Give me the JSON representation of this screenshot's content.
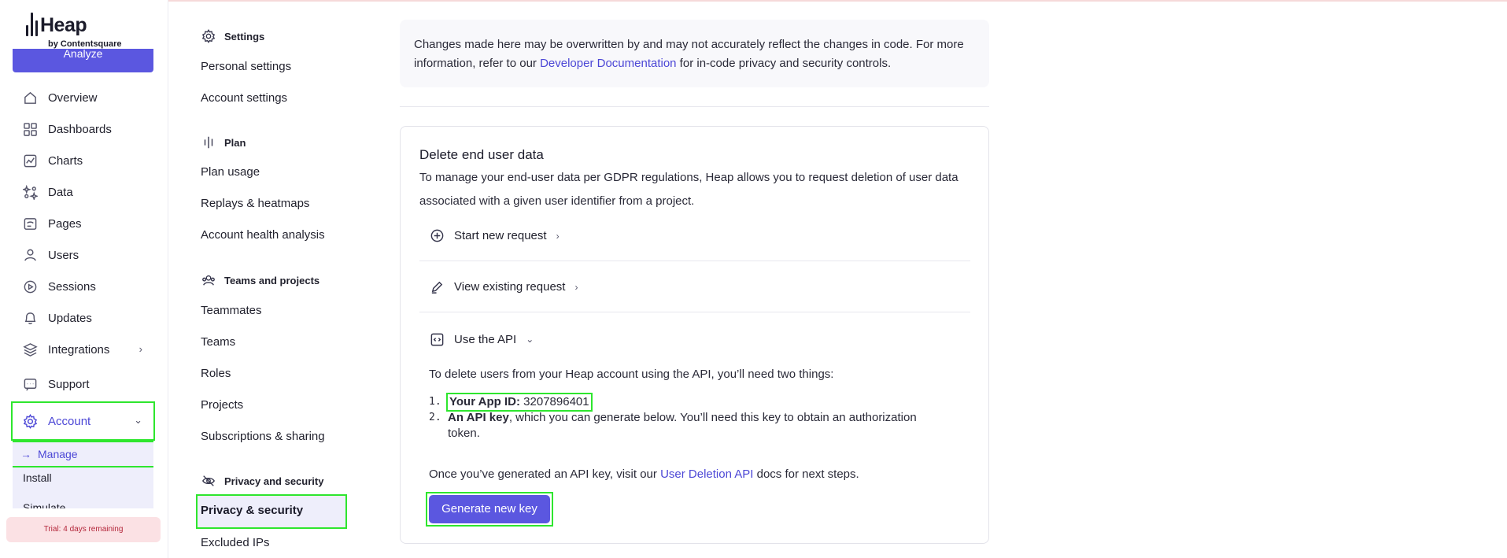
{
  "brand": {
    "name": "Heap",
    "byline": "by Contentsquare"
  },
  "nav": {
    "analyze_label": "Analyze",
    "items": [
      {
        "label": "Overview",
        "icon": "home-icon"
      },
      {
        "label": "Dashboards",
        "icon": "grid-icon"
      },
      {
        "label": "Charts",
        "icon": "chart-icon"
      },
      {
        "label": "Data",
        "icon": "sparkle-icon"
      },
      {
        "label": "Pages",
        "icon": "pages-icon"
      },
      {
        "label": "Users",
        "icon": "users-icon"
      },
      {
        "label": "Sessions",
        "icon": "play-icon"
      },
      {
        "label": "Updates",
        "icon": "bell-icon"
      },
      {
        "label": "Integrations",
        "icon": "layers-icon"
      },
      {
        "label": "Support",
        "icon": "support-icon"
      },
      {
        "label": "Account",
        "icon": "gear-icon"
      }
    ],
    "sub_items": [
      "Manage",
      "Install",
      "Simulate"
    ],
    "trial": "Trial: 4 days remaining"
  },
  "settings_col": {
    "sections": [
      {
        "title": "Settings",
        "links": [
          "Personal settings",
          "Account settings"
        ]
      },
      {
        "title": "Plan",
        "links": [
          "Plan usage",
          "Replays & heatmaps",
          "Account health analysis"
        ]
      },
      {
        "title": "Teams and projects",
        "links": [
          "Teammates",
          "Teams",
          "Roles",
          "Projects",
          "Subscriptions & sharing"
        ]
      },
      {
        "title": "Privacy and security",
        "links": [
          "Privacy & security",
          "Excluded IPs"
        ]
      }
    ]
  },
  "main": {
    "notice_1": "Changes made here may be overwritten by and may not accurately reflect the changes in code. For more information, refer to our ",
    "notice_link": "Developer Documentation",
    "notice_2": " for in-code privacy and security controls.",
    "card_title": "Delete end user data",
    "card_desc": "To manage your end-user data per GDPR regulations, Heap allows you to request deletion of user data associated with a given user identifier from a project.",
    "rows": [
      "Start new request",
      "View existing request",
      "Use the API"
    ],
    "api_intro": "To delete users from your Heap account using the API, you’ll need two things:",
    "item1_label": "Your App ID:",
    "item1_value": "3207896401",
    "item2_label": "An API key",
    "item2_text": ", which you can generate below. You’ll need this key to obtain an authorization token.",
    "after_1": "Once you’ve generated an API key, visit our ",
    "after_link": "User Deletion API",
    "after_2": " docs for next steps.",
    "button": "Generate new key"
  }
}
